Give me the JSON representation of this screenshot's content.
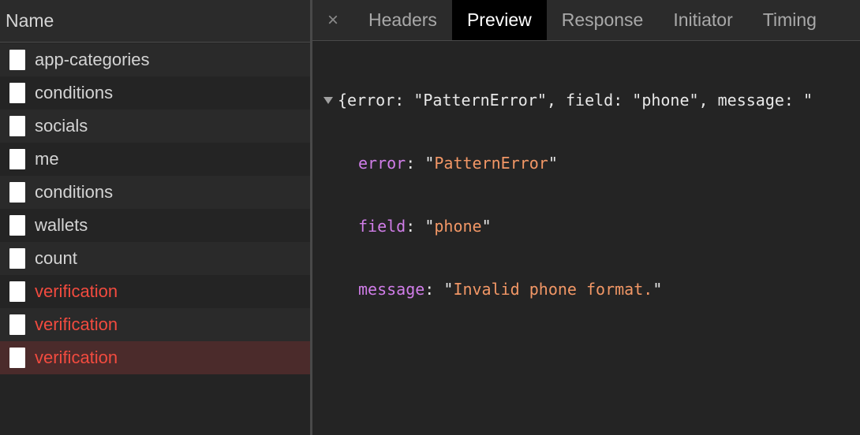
{
  "requests": {
    "header": "Name",
    "items": [
      {
        "label": "app-categories",
        "status": "ok"
      },
      {
        "label": "conditions",
        "status": "ok"
      },
      {
        "label": "socials",
        "status": "ok"
      },
      {
        "label": "me",
        "status": "ok"
      },
      {
        "label": "conditions",
        "status": "ok"
      },
      {
        "label": "wallets",
        "status": "ok"
      },
      {
        "label": "count",
        "status": "ok"
      },
      {
        "label": "verification",
        "status": "error"
      },
      {
        "label": "verification",
        "status": "error"
      },
      {
        "label": "verification",
        "status": "error",
        "selected": true
      }
    ]
  },
  "details": {
    "close_icon": "×",
    "tabs": [
      {
        "label": "Headers",
        "active": false
      },
      {
        "label": "Preview",
        "active": true
      },
      {
        "label": "Response",
        "active": false
      },
      {
        "label": "Initiator",
        "active": false
      },
      {
        "label": "Timing",
        "active": false
      }
    ]
  },
  "preview": {
    "summary": "{error: \"PatternError\", field: \"phone\", message: \"",
    "properties": [
      {
        "key": "error",
        "value": "PatternError"
      },
      {
        "key": "field",
        "value": "phone"
      },
      {
        "key": "message",
        "value": "Invalid phone format."
      }
    ]
  },
  "colors": {
    "error_text": "#f24b3f",
    "selected_row": "#4b2b2b",
    "json_key": "#d07de8",
    "json_string": "#f29766",
    "active_tab_bg": "#000000"
  }
}
